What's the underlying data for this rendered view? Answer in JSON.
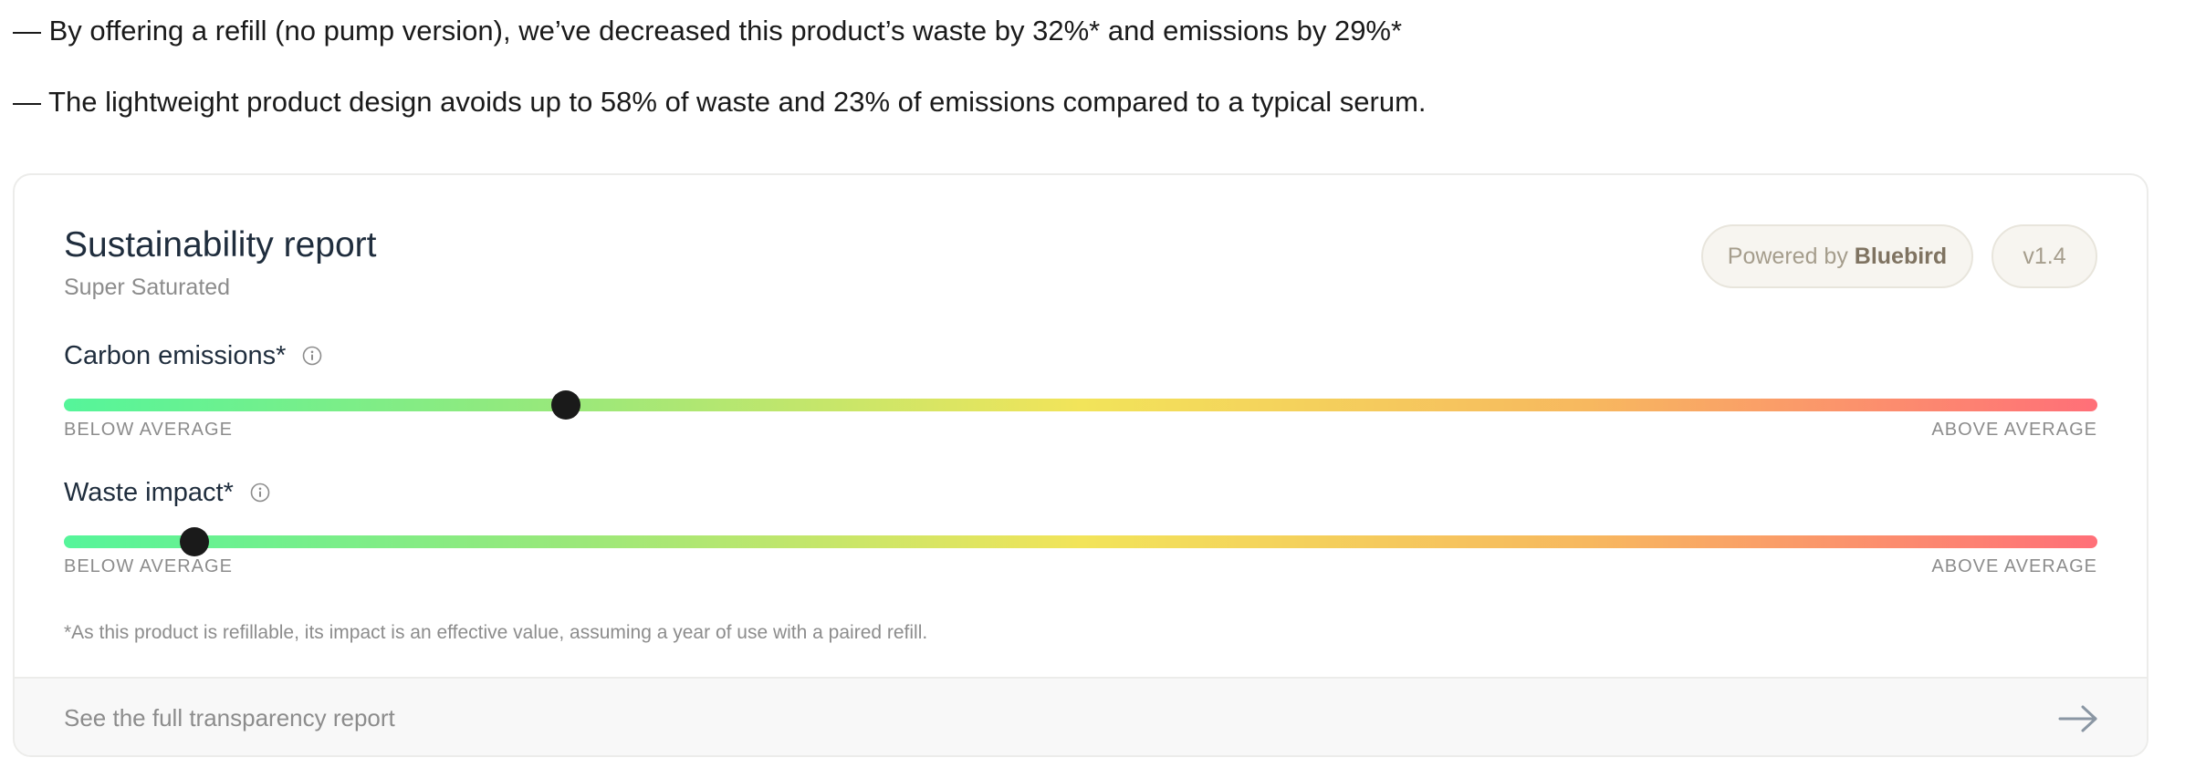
{
  "claims": [
    "— By offering a refill (no pump version), we’ve decreased this product’s waste by 32%* and emissions by 29%*",
    "— The lightweight product design avoids up to 58% of waste and 23% of emissions compared to a typical serum."
  ],
  "report": {
    "title": "Sustainability report",
    "subtitle": "Super Saturated",
    "powered_prefix": "Powered by",
    "powered_brand": "Bluebird",
    "version": "v1.4",
    "metrics": [
      {
        "label": "Carbon emissions*",
        "icon": "info-icon",
        "position_fraction": 0.247,
        "low_label": "BELOW AVERAGE",
        "high_label": "ABOVE AVERAGE"
      },
      {
        "label": "Waste impact*",
        "icon": "info-icon",
        "position_fraction": 0.064,
        "low_label": "BELOW AVERAGE",
        "high_label": "ABOVE AVERAGE"
      }
    ],
    "footnote": "*As this product is refillable, its impact is an effective value, assuming a year of use with a paired refill.",
    "footer_link": "See the full transparency report",
    "footer_icon": "arrow-right-icon"
  },
  "colors": {
    "scale_low": "#55f59a",
    "scale_mid": "#f2e45a",
    "scale_high": "#ff6f78",
    "knob": "#1a1a1a",
    "brand_text": "#7f7361"
  }
}
